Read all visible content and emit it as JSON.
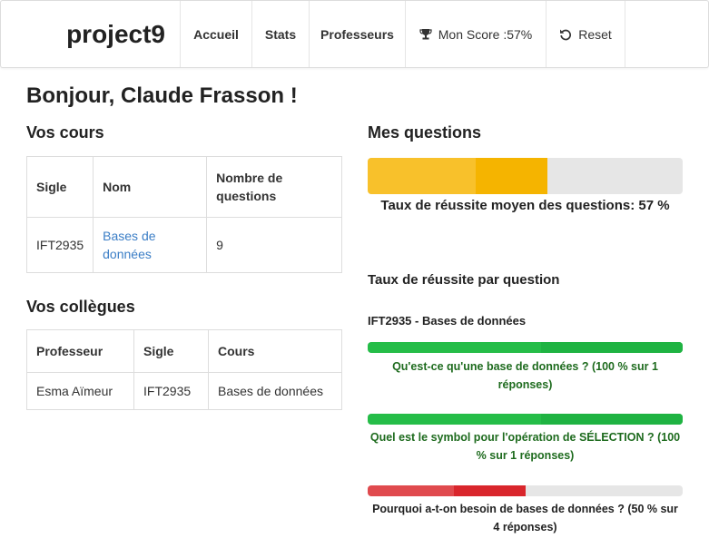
{
  "navbar": {
    "brand": "project9",
    "items": [
      {
        "label": "Accueil"
      },
      {
        "label": "Stats"
      },
      {
        "label": "Professeurs"
      },
      {
        "label": "Mon Score :57%",
        "icon": "trophy-icon"
      },
      {
        "label": "Reset",
        "icon": "reset-icon"
      }
    ]
  },
  "greeting": "Bonjour, Claude Frasson !",
  "courses": {
    "title": "Vos cours",
    "headers": [
      "Sigle",
      "Nom",
      "Nombre de questions"
    ],
    "rows": [
      {
        "sigle": "IFT2935",
        "nom": "Bases de données",
        "count": "9"
      }
    ]
  },
  "colleagues": {
    "title": "Vos collègues",
    "headers": [
      "Professeur",
      "Sigle",
      "Cours"
    ],
    "rows": [
      {
        "professeur": "Esma Aïmeur",
        "sigle": "IFT2935",
        "cours": "Bases de données"
      }
    ]
  },
  "questions": {
    "title": "Mes questions",
    "average_percent": 57,
    "average_caption": "Taux de réussite moyen des questions: 57 %",
    "per_question_title": "Taux de réussite par question",
    "course_label": "IFT2935 - Bases de données",
    "items": [
      {
        "label": "Qu'est-ce qu'une base de données ? (100 % sur 1 réponses)",
        "percent": 100,
        "status": "success"
      },
      {
        "label": "Quel est le symbol pour l'opération de SÉLECTION ? (100 % sur 1 réponses)",
        "percent": 100,
        "status": "success"
      },
      {
        "label": "Pourquoi a-t-on besoin de bases de données ? (50 % sur 4 réponses)",
        "percent": 50,
        "status": "danger"
      }
    ]
  },
  "colors": {
    "warning": "#f5b400",
    "success": "#22b846",
    "success_text": "#1e6b1e",
    "danger": "#d9262c",
    "danger_text": "#222222",
    "link": "#3b7ec6"
  }
}
